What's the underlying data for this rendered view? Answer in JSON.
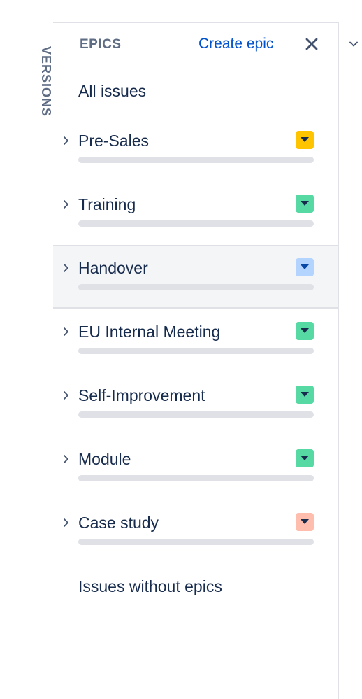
{
  "versions_tab": {
    "label": "VERSIONS"
  },
  "panel": {
    "title": "EPICS",
    "create_label": "Create epic",
    "all_issues_label": "All issues",
    "no_epic_label": "Issues without epics"
  },
  "epics": [
    {
      "name": "Pre-Sales",
      "color": "#ffc400",
      "arrow_color": "#172b4d",
      "selected": false,
      "progress": 0
    },
    {
      "name": "Training",
      "color": "#57d9a3",
      "arrow_color": "#172b4d",
      "selected": false,
      "progress": 0
    },
    {
      "name": "Handover",
      "color": "#b3d4ff",
      "arrow_color": "#0747a6",
      "selected": true,
      "progress": 0
    },
    {
      "name": "EU Internal Meeting",
      "color": "#57d9a3",
      "arrow_color": "#172b4d",
      "selected": false,
      "progress": 0
    },
    {
      "name": "Self-Improvement",
      "color": "#57d9a3",
      "arrow_color": "#172b4d",
      "selected": false,
      "progress": 0
    },
    {
      "name": "Module",
      "color": "#57d9a3",
      "arrow_color": "#172b4d",
      "selected": false,
      "progress": 0
    },
    {
      "name": "Case study",
      "color": "#ffbdad",
      "arrow_color": "#172b4d",
      "selected": false,
      "progress": 0
    }
  ],
  "icons": {
    "close": "close-icon",
    "expand": "chevron-right-icon",
    "color_menu": "chevron-down-icon",
    "outer_toggle": "chevron-down-icon"
  },
  "colors": {
    "accent": "#0052cc",
    "text": "#172b4d",
    "muted": "#5e6c84",
    "progress_track": "#dfe1e6",
    "selected_bg": "#f4f5f7"
  }
}
